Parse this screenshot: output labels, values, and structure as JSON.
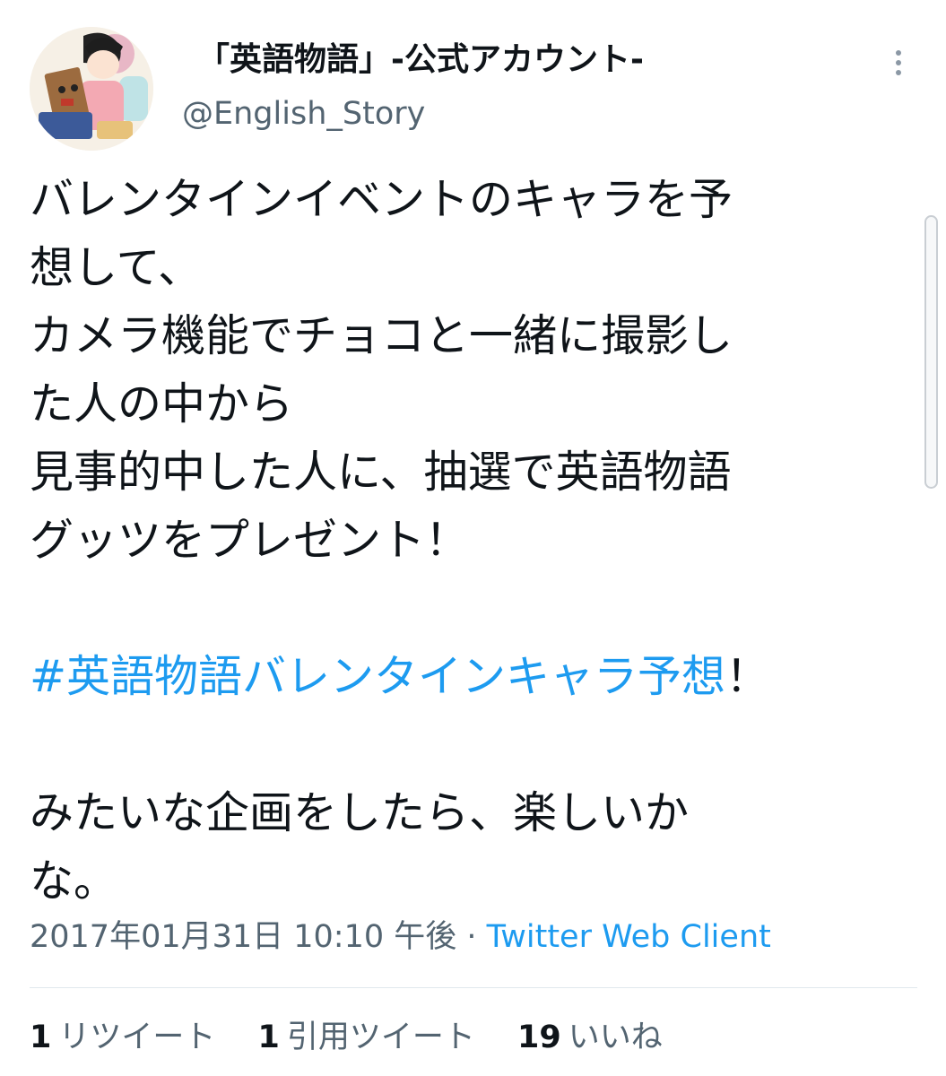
{
  "author": {
    "display_name": "「英語物語」-公式アカウント-",
    "handle": "@English_Story"
  },
  "tweet": {
    "lines": [
      "バレンタインイベントのキャラを予",
      "想して、",
      "カメラ機能でチョコと一緒に撮影し",
      "た人の中から",
      "見事的中した人に、抽選で英語物語",
      "グッツをプレゼント！"
    ],
    "hashtag": "#英語物語バレンタインキャラ予想",
    "hashtag_suffix": "！",
    "closing_lines": [
      "みたいな企画をしたら、楽しいか",
      "な。"
    ]
  },
  "meta": {
    "timestamp": "2017年01月31日 10:10 午後",
    "separator": " · ",
    "source": "Twitter Web Client"
  },
  "stats": {
    "retweets_count": "1",
    "retweets_label": "リツイート",
    "quotes_count": "1",
    "quotes_label": "引用ツイート",
    "likes_count": "19",
    "likes_label": "いいね"
  },
  "colors": {
    "link": "#1d9bf0",
    "secondary_text": "#536471",
    "primary_text": "#0f1419"
  },
  "icons": {
    "menu": "more-vertical-icon"
  }
}
